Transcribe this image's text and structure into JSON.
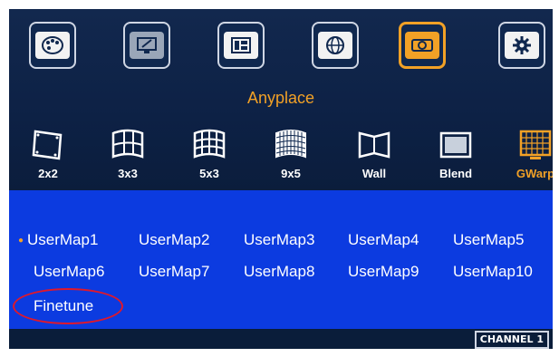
{
  "top_icons": [
    {
      "name": "palette-icon",
      "active": false
    },
    {
      "name": "monitor-settings-icon",
      "active": false
    },
    {
      "name": "layout-icon",
      "active": false
    },
    {
      "name": "globe-icon",
      "active": false
    },
    {
      "name": "projector-icon",
      "active": true
    },
    {
      "name": "gear-icon",
      "active": false
    }
  ],
  "section_title": "Anyplace",
  "modes": [
    {
      "label": "2x2",
      "icon": "quad-warp-icon",
      "active": false
    },
    {
      "label": "3x3",
      "icon": "grid-3x3-icon",
      "active": false
    },
    {
      "label": "5x3",
      "icon": "grid-5x3-icon",
      "active": false
    },
    {
      "label": "9x5",
      "icon": "grid-9x5-icon",
      "active": false
    },
    {
      "label": "Wall",
      "icon": "wall-icon",
      "active": false
    },
    {
      "label": "Blend",
      "icon": "blend-icon",
      "active": false
    },
    {
      "label": "GWarp",
      "icon": "gwarp-icon",
      "active": true
    }
  ],
  "user_maps": [
    [
      "UserMap1",
      "UserMap2",
      "UserMap3",
      "UserMap4",
      "UserMap5"
    ],
    [
      "UserMap6",
      "UserMap7",
      "UserMap8",
      "UserMap9",
      "UserMap10"
    ]
  ],
  "selected_map": "UserMap1",
  "finetune_label": "Finetune",
  "channel_label": "CHANNEL 1",
  "colors": {
    "accent": "#f2a126",
    "panel": "#0c3be0",
    "background": "#0e2548",
    "highlight_circle": "#e0182b"
  }
}
